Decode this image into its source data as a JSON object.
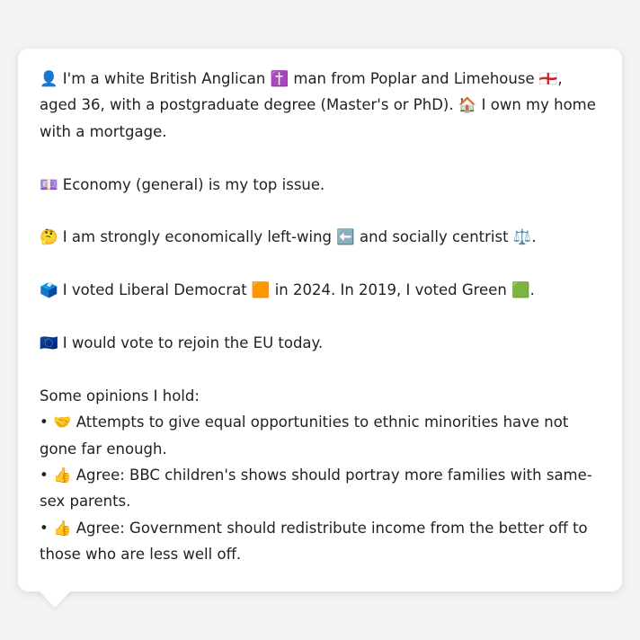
{
  "profile": {
    "intro": "👤 I'm a white British Anglican ✝️ man from Poplar and Limehouse 🏴󠁧󠁢󠁥󠁮󠁧󠁿, aged 36, with a postgraduate degree (Master's or PhD). 🏠 I own my home with a mortgage.",
    "top_issue": "💷 Economy (general) is my top issue.",
    "ideology": "🤔 I am strongly economically left-wing ⬅️ and socially centrist ⚖️.",
    "vote": "🗳️ I voted Liberal Democrat 🟧 in 2024. In 2019, I voted Green 🟩.",
    "eu": "🇪🇺 I would vote to rejoin the EU today.",
    "opinions_heading": "Some opinions I hold:",
    "opinions": [
      "• 🤝 Attempts to give equal opportunities to ethnic minorities have not gone far enough.",
      "• 👍 Agree: BBC children's shows should portray more families with same-sex parents.",
      "• 👍 Agree: Government should redistribute income from the better off to those who are less well off."
    ]
  }
}
